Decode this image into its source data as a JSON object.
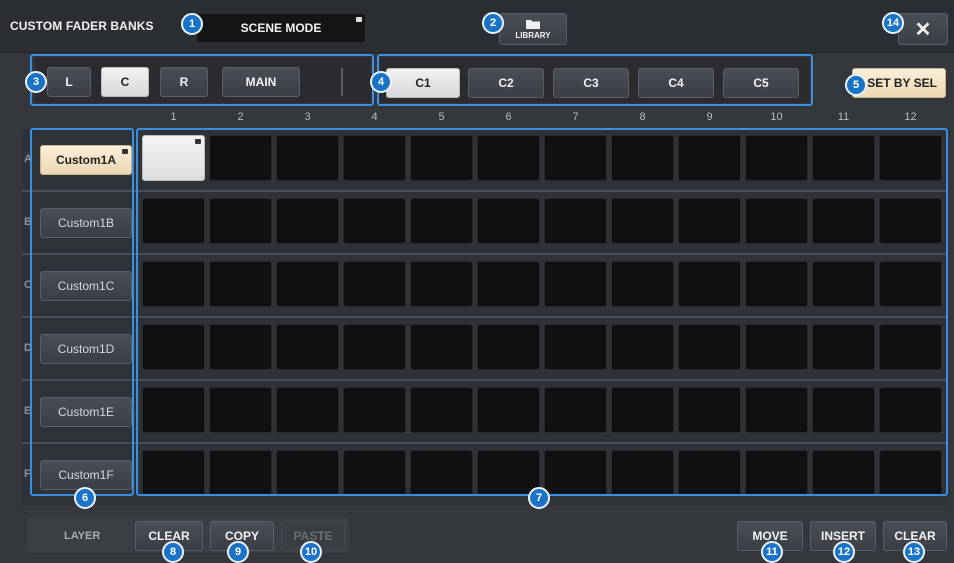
{
  "header": {
    "title": "CUSTOM FADER BANKS",
    "scene_mode_label": "SCENE MODE",
    "library_label": "LIBRARY",
    "close_glyph": "✕"
  },
  "layer_tabs": [
    "L",
    "C",
    "R",
    "MAIN"
  ],
  "layer_tab_selected": "C",
  "bank_tabs": [
    "C1",
    "C2",
    "C3",
    "C4",
    "C5"
  ],
  "bank_tab_selected": "C1",
  "set_by_sel_label": "SET BY SEL",
  "columns": [
    "1",
    "2",
    "3",
    "4",
    "5",
    "6",
    "7",
    "8",
    "9",
    "10",
    "11",
    "12"
  ],
  "rows": [
    {
      "letter": "A",
      "label": "Custom1A",
      "selected": true
    },
    {
      "letter": "B",
      "label": "Custom1B",
      "selected": false
    },
    {
      "letter": "C",
      "label": "Custom1C",
      "selected": false
    },
    {
      "letter": "D",
      "label": "Custom1D",
      "selected": false
    },
    {
      "letter": "E",
      "label": "Custom1E",
      "selected": false
    },
    {
      "letter": "F",
      "label": "Custom1F",
      "selected": false
    }
  ],
  "selected_cell": {
    "row": "A",
    "column": "1"
  },
  "bottom": {
    "layer_label": "LAYER",
    "clear_label": "CLEAR",
    "copy_label": "COPY",
    "paste_label": "PASTE",
    "move_label": "MOVE",
    "insert_label": "INSERT",
    "clear2_label": "CLEAR"
  },
  "callouts": [
    "1",
    "2",
    "3",
    "4",
    "5",
    "6",
    "7",
    "8",
    "9",
    "10",
    "11",
    "12",
    "13",
    "14"
  ],
  "colors": {
    "accent": "#1a73c7",
    "selected_cream": "#f4e6c8",
    "cell_bg": "#0f1012",
    "panel_bg": "#34373c"
  }
}
